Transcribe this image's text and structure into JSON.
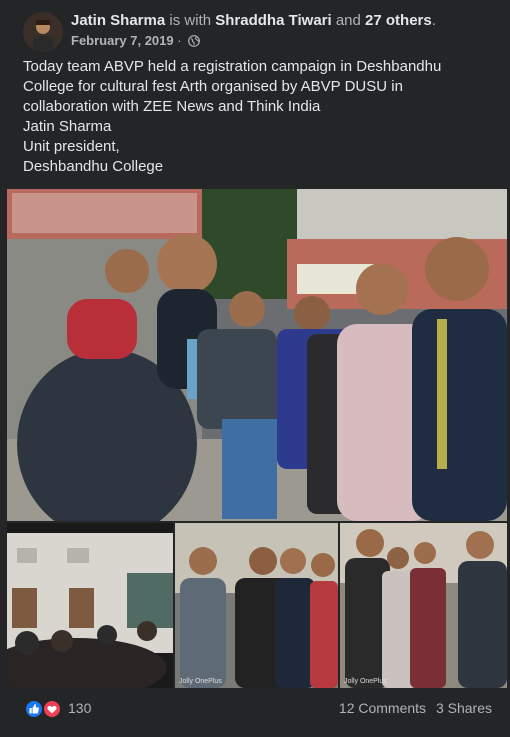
{
  "post": {
    "author": "Jatin Sharma",
    "with_word": "is with",
    "tagged_person": "Shraddha Tiwari",
    "and_word": "and",
    "others": "27 others",
    "period": ".",
    "date": "February 7, 2019",
    "separator": "·",
    "privacy_icon": "globe-icon",
    "text_lines": [
      "Today team ABVP held a registration campaign in Deshbandhu",
      "College for cultural fest Arth organised by ABVP DUSU in",
      "collaboration with ZEE News and Think India",
      "Jatin Sharma",
      "Unit president,",
      "Deshbandhu College"
    ]
  },
  "photos": {
    "watermark": "Jolly OnePlus"
  },
  "footer": {
    "reaction_icons": [
      "like-icon",
      "love-icon"
    ],
    "reaction_count": "130",
    "comments": "12 Comments",
    "shares": "3 Shares"
  },
  "colors": {
    "background": "#242526",
    "text": "#e4e6eb",
    "muted": "#b0b3b8",
    "like": "#1877f2",
    "love": "#f33e58"
  }
}
